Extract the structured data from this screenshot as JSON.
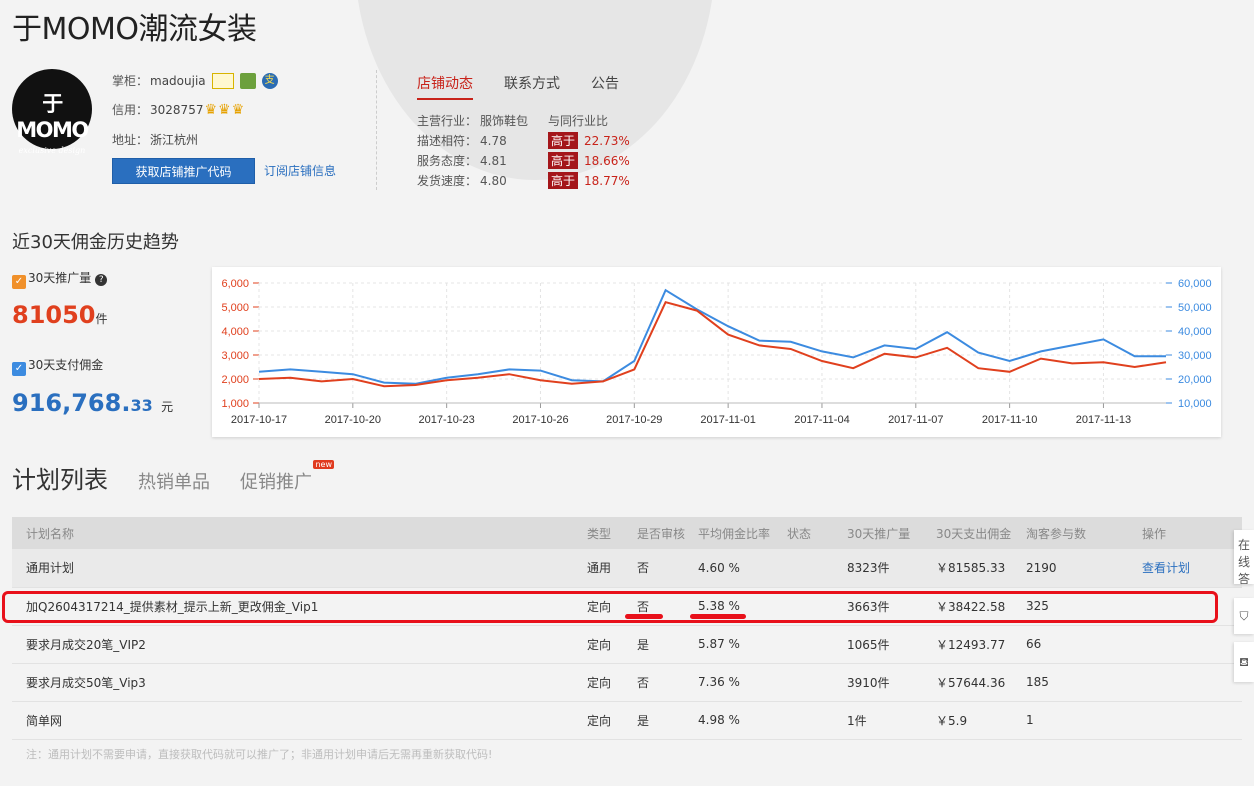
{
  "shop": {
    "title": "于MOMO潮流女装",
    "logo_text": "于MOMO",
    "logo_sub": "exclusive design",
    "owner_label": "掌柜：",
    "owner": "madoujia",
    "credit_label": "信用：",
    "credit": "3028757",
    "address_label": "地址：",
    "address": "浙江杭州",
    "promo_button": "获取店铺推广代码",
    "subscribe_link": "订阅店铺信息",
    "badge3_text": "支",
    "crown_glyph": "♛"
  },
  "tabs": [
    "店铺动态",
    "联系方式",
    "公告"
  ],
  "dsr": {
    "industry_label": "主营行业：",
    "industry": "服饰鞋包",
    "compare_label": "与同行业比",
    "rows": [
      {
        "label": "描述相符：",
        "score": "4.78",
        "level": "高于",
        "pct": "22.73%"
      },
      {
        "label": "服务态度：",
        "score": "4.81",
        "level": "高于",
        "pct": "18.66%"
      },
      {
        "label": "发货速度：",
        "score": "4.80",
        "level": "高于",
        "pct": "18.77%"
      }
    ]
  },
  "trend": {
    "title": "近30天佣金历史趋势",
    "metric1_label": "30天推广量",
    "metric1_value": "81050",
    "metric1_unit": "件",
    "metric2_label": "30天支付佣金",
    "metric2_value": "916,768.",
    "metric2_decimal": "33",
    "metric2_unit": "元",
    "help_icon_text": "?",
    "check_glyph": "✓"
  },
  "chart_data": {
    "type": "line",
    "x": [
      "2017-10-17",
      "2017-10-18",
      "2017-10-19",
      "2017-10-20",
      "2017-10-21",
      "2017-10-22",
      "2017-10-23",
      "2017-10-24",
      "2017-10-25",
      "2017-10-26",
      "2017-10-27",
      "2017-10-28",
      "2017-10-29",
      "2017-10-30",
      "2017-10-31",
      "2017-11-01",
      "2017-11-02",
      "2017-11-03",
      "2017-11-04",
      "2017-11-05",
      "2017-11-06",
      "2017-11-07",
      "2017-11-08",
      "2017-11-09",
      "2017-11-10",
      "2017-11-11",
      "2017-11-12",
      "2017-11-13",
      "2017-11-14",
      "2017-11-15"
    ],
    "x_tick_labels": [
      "2017-10-17",
      "2017-10-20",
      "2017-10-23",
      "2017-10-26",
      "2017-10-29",
      "2017-11-01",
      "2017-11-04",
      "2017-11-07",
      "2017-11-10",
      "2017-11-13"
    ],
    "y_left_ticks": [
      "1,000",
      "2,000",
      "3,000",
      "4,000",
      "5,000",
      "6,000"
    ],
    "y_right_ticks": [
      "10,000",
      "20,000",
      "30,000",
      "40,000",
      "50,000",
      "60,000"
    ],
    "ylim_left": [
      1000,
      6000
    ],
    "ylim_right": [
      10000,
      60000
    ],
    "grid": true,
    "series": [
      {
        "color": "#e0401e",
        "axis": "left",
        "values": [
          2000,
          2050,
          1900,
          2000,
          1700,
          1750,
          1950,
          2050,
          2200,
          1950,
          1800,
          1900,
          2400,
          5200,
          4850,
          3850,
          3400,
          3250,
          2750,
          2450,
          3050,
          2900,
          3300,
          2450,
          2300,
          2850,
          2650,
          2700,
          2500,
          2700
        ]
      },
      {
        "color": "#3c8be0",
        "axis": "right",
        "values": [
          23000,
          24000,
          23000,
          22000,
          18500,
          18000,
          20500,
          22000,
          24000,
          23500,
          19500,
          19000,
          27500,
          57000,
          49000,
          42000,
          36000,
          35500,
          31500,
          29000,
          34000,
          32500,
          39500,
          31000,
          27500,
          31500,
          34000,
          36500,
          29500,
          29500
        ]
      }
    ]
  },
  "plan_tabs": [
    {
      "label": "计划列表",
      "active": true,
      "new": false
    },
    {
      "label": "热销单品",
      "active": false,
      "new": false
    },
    {
      "label": "促销推广",
      "active": false,
      "new": true,
      "tag": "new"
    }
  ],
  "table": {
    "headers": [
      "计划名称",
      "类型",
      "是否审核",
      "平均佣金比率",
      "状态",
      "30天推广量",
      "30天支出佣金",
      "淘客参与数",
      "操作"
    ],
    "rows": [
      [
        "通用计划",
        "通用",
        "否",
        "4.60 %",
        "",
        "8323件",
        "￥81585.33",
        "2190",
        "查看计划"
      ],
      [
        "加Q2604317214_提供素材_提示上新_更改佣金_Vip1",
        "定向",
        "否",
        "5.38 %",
        "",
        "3663件",
        "￥38422.58",
        "325",
        ""
      ],
      [
        "要求月成交20笔_VIP2",
        "定向",
        "是",
        "5.87 %",
        "",
        "1065件",
        "￥12493.77",
        "66",
        ""
      ],
      [
        "要求月成交50笔_Vip3",
        "定向",
        "否",
        "7.36 %",
        "",
        "3910件",
        "￥57644.36",
        "185",
        ""
      ],
      [
        "简单网",
        "定向",
        "是",
        "4.98 %",
        "",
        "1件",
        "￥5.9",
        "1",
        ""
      ]
    ]
  },
  "footnote": "注：通用计划不需要申请，直接获取代码就可以推广了；非通用计划申请后无需再重新获取代码!",
  "side": {
    "online_text": "在线答",
    "icon1": "⛉",
    "icon2": "⛾"
  }
}
